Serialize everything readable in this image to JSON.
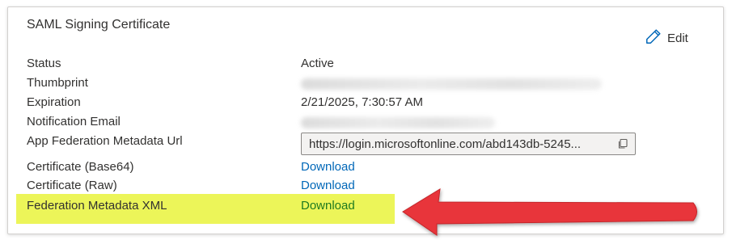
{
  "card": {
    "title": "SAML Signing Certificate",
    "edit_label": "Edit",
    "rows": {
      "status": {
        "label": "Status",
        "value": "Active"
      },
      "thumbprint": {
        "label": "Thumbprint"
      },
      "expiration": {
        "label": "Expiration",
        "value": "2/21/2025, 7:30:57 AM"
      },
      "notification_email": {
        "label": "Notification Email"
      },
      "metadata_url": {
        "label": "App Federation Metadata Url",
        "value": "https://login.microsoftonline.com/abd143db-5245..."
      },
      "cert_base64": {
        "label": "Certificate (Base64)",
        "link": "Download"
      },
      "cert_raw": {
        "label": "Certificate (Raw)",
        "link": "Download"
      },
      "federation_xml": {
        "label": "Federation Metadata XML",
        "link": "Download"
      }
    }
  },
  "colors": {
    "link": "#0067b8",
    "highlight": "#ecf559",
    "highlight_link": "#1f7a1f",
    "arrow": "#e8353b"
  },
  "icons": [
    "pencil-icon",
    "copy-icon",
    "arrow-annotation"
  ]
}
